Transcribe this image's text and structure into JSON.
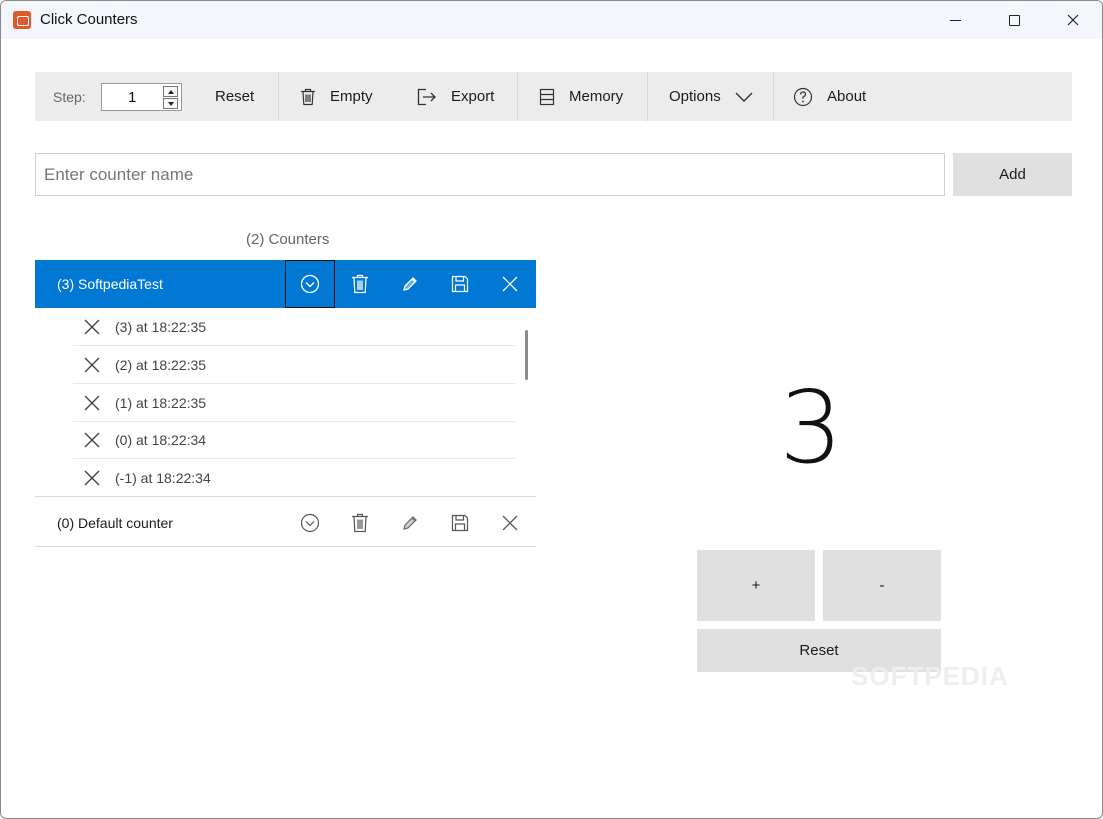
{
  "window": {
    "title": "Click Counters",
    "controls": [
      "minimize-icon",
      "maximize-icon",
      "close-icon"
    ]
  },
  "toolbar": {
    "step_label": "Step:",
    "step_value": "1",
    "reset_label": "Reset",
    "empty_label": "Empty",
    "export_label": "Export",
    "memory_label": "Memory",
    "options_label": "Options",
    "about_label": "About",
    "icons": [
      "trash-icon",
      "export-icon",
      "memory-icon",
      "chevron-down-icon",
      "help-icon"
    ]
  },
  "name_entry": {
    "placeholder": "Enter counter name",
    "value": "",
    "add_label": "Add"
  },
  "counters_header": "(2) Counters",
  "counters": [
    {
      "name": "(3) SoftpediaTest",
      "selected": true,
      "actions": [
        "select-icon",
        "trash-icon",
        "edit-icon",
        "save-icon",
        "close-icon"
      ],
      "history": [
        {
          "text": "(3) at 18:22:35"
        },
        {
          "text": "(2) at 18:22:35"
        },
        {
          "text": "(1) at 18:22:35"
        },
        {
          "text": "(0) at 18:22:34"
        },
        {
          "text": "(-1) at 18:22:34"
        }
      ]
    },
    {
      "name": "(0) Default counter",
      "selected": false,
      "actions": [
        "select-icon",
        "trash-icon",
        "edit-icon",
        "save-icon",
        "close-icon"
      ]
    }
  ],
  "display": {
    "count": "3",
    "plus_label": "+",
    "minus_label": "-",
    "reset_label": "Reset"
  },
  "watermark": "SOFTPEDIA",
  "colors": {
    "accent": "#0078d4",
    "button_bg": "#e0e0e0",
    "toolbar_bg": "#ececec"
  }
}
